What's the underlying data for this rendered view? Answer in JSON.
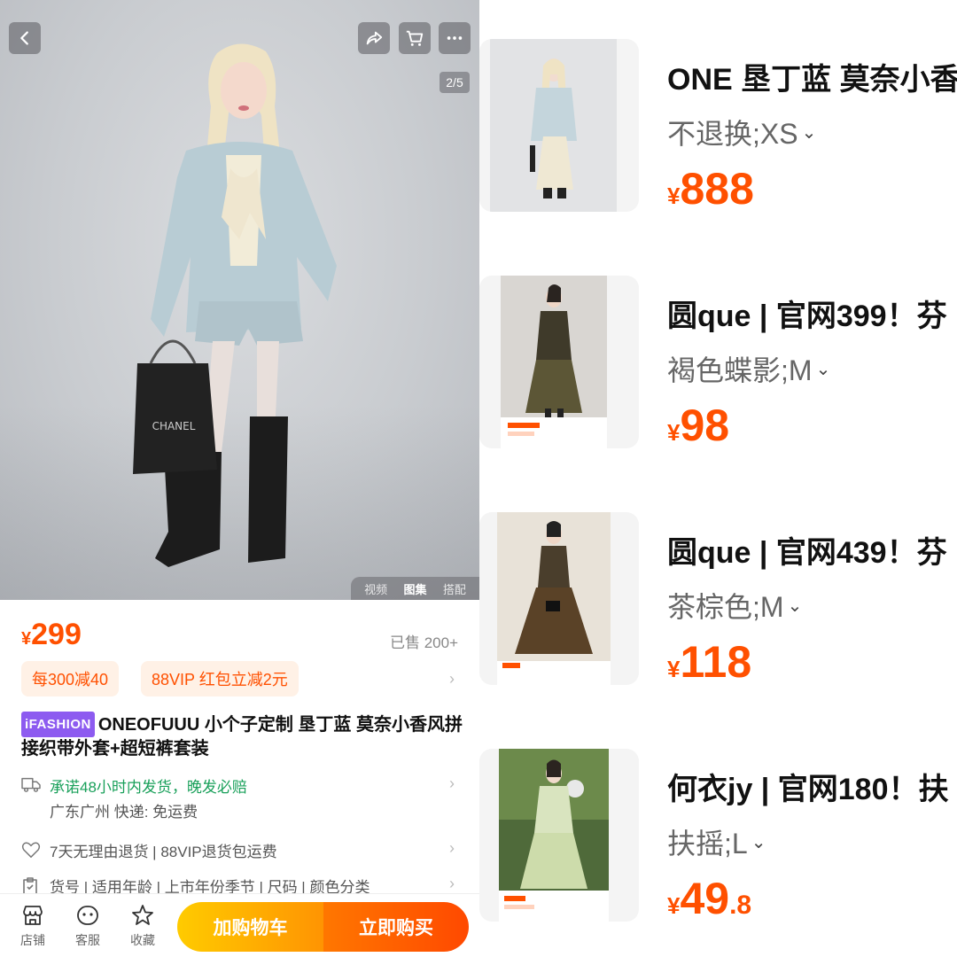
{
  "left": {
    "image_counter": "2/5",
    "media_tabs": [
      "视频",
      "图集",
      "搭配"
    ],
    "price": {
      "currency": "¥",
      "value": "299"
    },
    "sold": "已售 200+",
    "promos": [
      "每300减40",
      "88VIP 红包立减2元"
    ],
    "title": {
      "badge": "iFASHION",
      "text": "ONEOFUUU 小个子定制 垦丁蓝 莫奈小香风拼接织带外套+超短裤套装"
    },
    "shipping": {
      "main": "承诺48小时内发货，晚发必赔",
      "sub": "广东广州  快递: 免运费"
    },
    "returns": "7天无理由退货 | 88VIP退货包运费",
    "params": "货号 | 适用年龄 | 上市年份季节 | 尺码 | 颜色分类",
    "bottom": {
      "store": "店铺",
      "service": "客服",
      "favorite": "收藏",
      "add_to_cart": "加购物车",
      "buy_now": "立即购买"
    }
  },
  "right": {
    "items": [
      {
        "title": "ONE  垦丁蓝 莫奈小香",
        "sku": "不退换;XS",
        "price_int": "888",
        "price_dec": ""
      },
      {
        "title": "圆que | 官网399！芬",
        "sku": "褐色蝶影;M",
        "price_int": "98",
        "price_dec": ""
      },
      {
        "title": "圆que | 官网439！芬",
        "sku": "茶棕色;M",
        "price_int": "118",
        "price_dec": ""
      },
      {
        "title": "何衣jy | 官网180！扶",
        "sku": "扶摇;L",
        "price_int": "49",
        "price_dec": ".8"
      }
    ],
    "currency": "¥"
  },
  "colors": {
    "accent": "#ff5000",
    "green": "#19a05a",
    "ifashion": "#8d5bf0"
  }
}
